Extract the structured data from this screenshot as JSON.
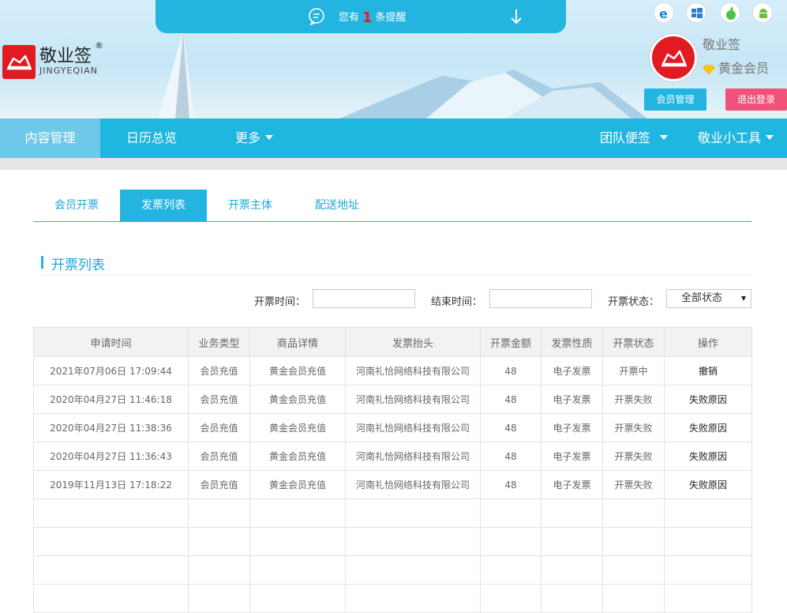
{
  "notice": {
    "prefix": "您有",
    "count": "1",
    "suffix": "条提醒"
  },
  "logo": {
    "name": "敬业签",
    "reg": "®",
    "en": "JINGYEQIAN"
  },
  "platforms": [
    "ie-icon",
    "windows-icon",
    "apple-icon",
    "android-icon"
  ],
  "user": {
    "name": "敬业签",
    "vip": "黄金会员",
    "member_btn": "会员管理",
    "logout_btn": "退出登录"
  },
  "nav": {
    "items": [
      "内容管理",
      "日历总览",
      "更多"
    ],
    "right": [
      "团队便签",
      "敬业小工具"
    ]
  },
  "tabs": [
    "会员开票",
    "发票列表",
    "开票主体",
    "配送地址"
  ],
  "section_title": "开票列表",
  "filters": {
    "start_label": "开票时间：",
    "end_label": "结束时间：",
    "status_label": "开票状态：",
    "status_value": "全部状态"
  },
  "table": {
    "headers": [
      "申请时间",
      "业务类型",
      "商品详情",
      "发票抬头",
      "开票金额",
      "发票性质",
      "开票状态",
      "操作"
    ],
    "rows": [
      [
        "2021年07月06日 17:09:44",
        "会员充值",
        "黄金会员充值",
        "河南礼恰网络科技有限公司",
        "48",
        "电子发票",
        "开票中",
        "撤销"
      ],
      [
        "2020年04月27日 11:46:18",
        "会员充值",
        "黄金会员充值",
        "河南礼恰网络科技有限公司",
        "48",
        "电子发票",
        "开票失败",
        "失败原因"
      ],
      [
        "2020年04月27日 11:38:36",
        "会员充值",
        "黄金会员充值",
        "河南礼恰网络科技有限公司",
        "48",
        "电子发票",
        "开票失败",
        "失败原因"
      ],
      [
        "2020年04月27日 11:36:43",
        "会员充值",
        "黄金会员充值",
        "河南礼恰网络科技有限公司",
        "48",
        "电子发票",
        "开票失败",
        "失败原因"
      ],
      [
        "2019年11月13日 17:18:22",
        "会员充值",
        "黄金会员充值",
        "河南礼恰网络科技有限公司",
        "48",
        "电子发票",
        "开票失败",
        "失败原因"
      ]
    ]
  },
  "colors": {
    "primary": "#23b5e0",
    "logout": "#f0527a",
    "brand_red": "#e11b22"
  }
}
